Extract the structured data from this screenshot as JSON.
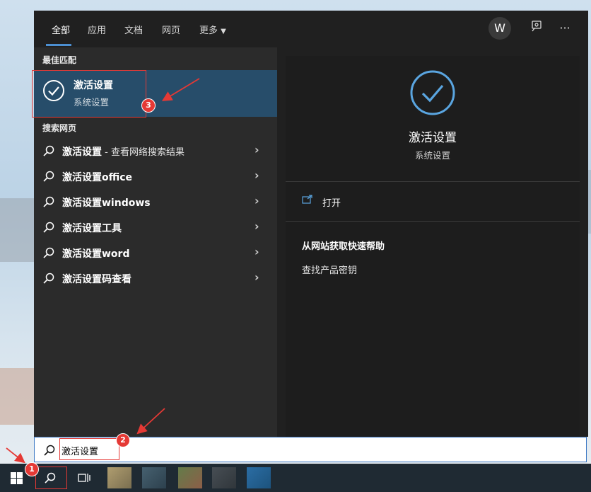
{
  "tabs": [
    {
      "label": "全部",
      "active": true
    },
    {
      "label": "应用"
    },
    {
      "label": "文档"
    },
    {
      "label": "网页"
    },
    {
      "label": "更多"
    }
  ],
  "account": {
    "initial": "W"
  },
  "sections": {
    "best_match": "最佳匹配",
    "search_web": "搜索网页"
  },
  "best_match": {
    "title": "激活设置",
    "subtitle": "系统设置"
  },
  "web_results": [
    {
      "label": "激活设置",
      "suffix": " - 查看网络搜索结果"
    },
    {
      "label": "激活设置office",
      "suffix": ""
    },
    {
      "label": "激活设置windows",
      "suffix": ""
    },
    {
      "label": "激活设置工具",
      "suffix": ""
    },
    {
      "label": "激活设置word",
      "suffix": ""
    },
    {
      "label": "激活设置码查看",
      "suffix": ""
    }
  ],
  "detail": {
    "title": "激活设置",
    "subtitle": "系统设置",
    "open_label": "打开",
    "help_title": "从网站获取快速帮助",
    "help_link": "查找产品密钥"
  },
  "search": {
    "value": "激活设置"
  },
  "annotations": [
    "1",
    "2",
    "3"
  ],
  "colors": {
    "accent": "#4c8fd1",
    "best_match_bg": "#274d6a",
    "annotation_red": "#e53935"
  }
}
